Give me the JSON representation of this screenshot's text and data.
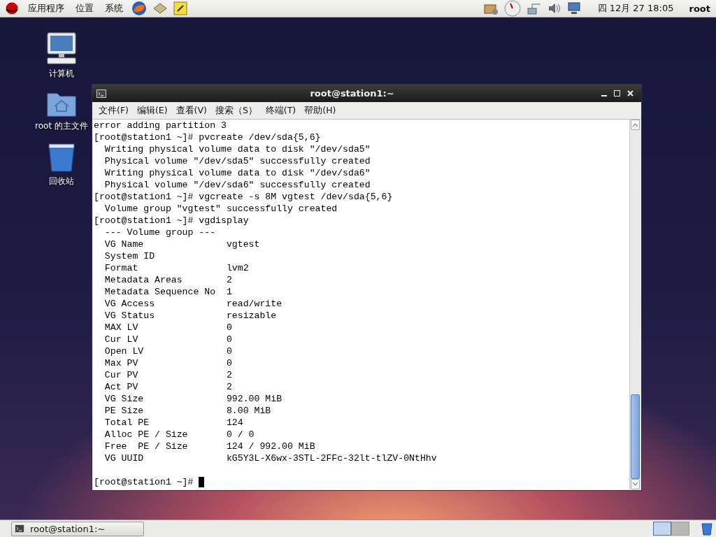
{
  "top_panel": {
    "menus": [
      "应用程序",
      "位置",
      "系统"
    ],
    "clock": "四 12月 27 18:05",
    "user": "root"
  },
  "desktop_icons": [
    {
      "kind": "computer",
      "label": "计算机"
    },
    {
      "kind": "home",
      "label": "root 的主文件"
    },
    {
      "kind": "trash",
      "label": "回收站"
    }
  ],
  "window": {
    "title": "root@station1:~",
    "menu": [
      "文件(F)",
      "编辑(E)",
      "查看(V)",
      "搜索（S）",
      "终端(T)",
      "帮助(H)"
    ],
    "terminal": {
      "lines": [
        "error adding partition 3",
        "[root@station1 ~]# pvcreate /dev/sda{5,6}",
        "  Writing physical volume data to disk \"/dev/sda5\"",
        "  Physical volume \"/dev/sda5\" successfully created",
        "  Writing physical volume data to disk \"/dev/sda6\"",
        "  Physical volume \"/dev/sda6\" successfully created",
        "[root@station1 ~]# vgcreate -s 8M vgtest /dev/sda{5,6}",
        "  Volume group \"vgtest\" successfully created",
        "[root@station1 ~]# vgdisplay",
        "  --- Volume group ---",
        "  VG Name               vgtest",
        "  System ID",
        "  Format                lvm2",
        "  Metadata Areas        2",
        "  Metadata Sequence No  1",
        "  VG Access             read/write",
        "  VG Status             resizable",
        "  MAX LV                0",
        "  Cur LV                0",
        "  Open LV               0",
        "  Max PV                0",
        "  Cur PV                2",
        "  Act PV                2",
        "  VG Size               992.00 MiB",
        "  PE Size               8.00 MiB",
        "  Total PE              124",
        "  Alloc PE / Size       0 / 0",
        "  Free  PE / Size       124 / 992.00 MiB",
        "  VG UUID               kG5Y3L-X6wx-3STL-2FFc-32lt-tlZV-0NtHhv"
      ],
      "prompt": "[root@station1 ~]# "
    }
  },
  "taskbar": {
    "tasks": [
      {
        "label": "root@station1:~",
        "selected": false
      }
    ],
    "workspaces": [
      {
        "selected": true
      },
      {
        "selected": false
      }
    ]
  }
}
